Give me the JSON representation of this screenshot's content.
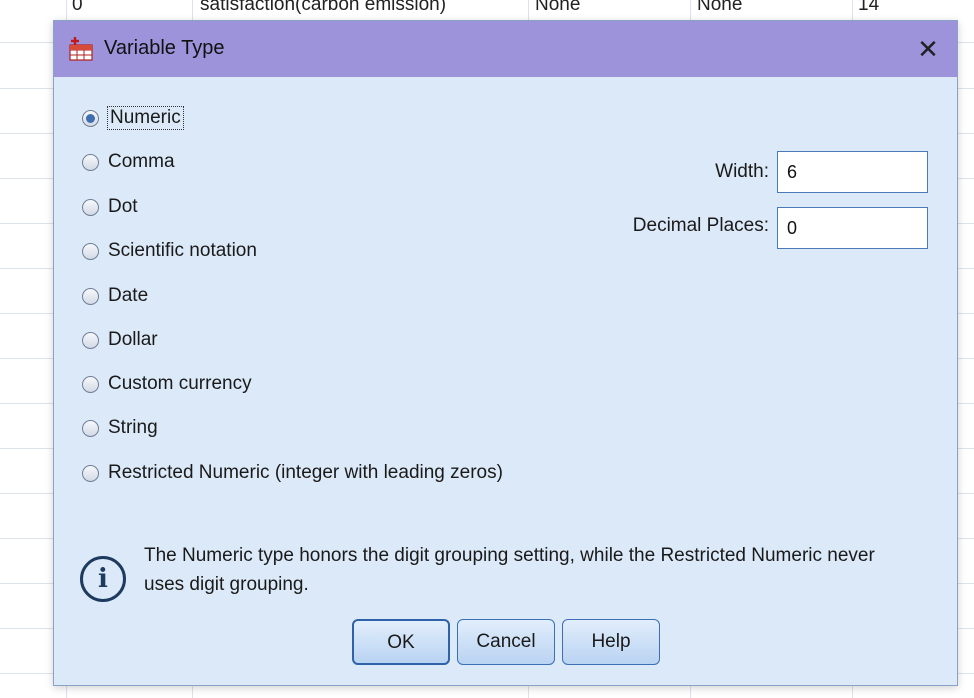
{
  "background": {
    "top_cells": [
      "0",
      "satisfaction(carbon emission)",
      "None",
      "None",
      "14"
    ]
  },
  "dialog": {
    "title": "Variable Type",
    "close_symbol": "✕",
    "title_icon": "variable-type-icon",
    "selected_type": "Numeric",
    "types": [
      {
        "label": "Numeric",
        "checked": true
      },
      {
        "label": "Comma",
        "checked": false
      },
      {
        "label": "Dot",
        "checked": false
      },
      {
        "label": "Scientific notation",
        "checked": false
      },
      {
        "label": "Date",
        "checked": false
      },
      {
        "label": "Dollar",
        "checked": false
      },
      {
        "label": "Custom currency",
        "checked": false
      },
      {
        "label": "String",
        "checked": false
      },
      {
        "label": "Restricted Numeric (integer with leading zeros)",
        "checked": false
      }
    ],
    "width_label": "Width:",
    "width_value": "6",
    "decimal_label": "Decimal Places:",
    "decimal_value": "0",
    "info_icon": "info-icon",
    "info_symbol": "i",
    "info_text": "The Numeric type honors the digit grouping setting, while the Restricted Numeric never uses digit grouping.",
    "buttons": {
      "ok": "OK",
      "cancel": "Cancel",
      "help": "Help"
    },
    "colors": {
      "titlebar": "#9c93db",
      "body": "#dce9f8",
      "button_border": "#3b70b7"
    }
  }
}
